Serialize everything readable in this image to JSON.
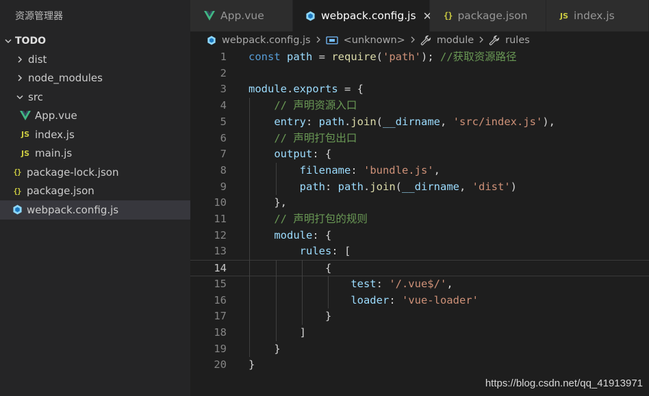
{
  "explorer": {
    "title": "资源管理器",
    "section": "TODO",
    "items": [
      {
        "label": "dist",
        "type": "folder"
      },
      {
        "label": "node_modules",
        "type": "folder"
      },
      {
        "label": "src",
        "type": "folder-open"
      },
      {
        "label": "App.vue",
        "type": "vue"
      },
      {
        "label": "index.js",
        "type": "js"
      },
      {
        "label": "main.js",
        "type": "js"
      },
      {
        "label": "package-lock.json",
        "type": "json"
      },
      {
        "label": "package.json",
        "type": "json"
      },
      {
        "label": "webpack.config.js",
        "type": "webpack",
        "selected": true
      }
    ]
  },
  "tabs": [
    {
      "label": "App.vue",
      "icon": "vue-icon"
    },
    {
      "label": "webpack.config.js",
      "icon": "webpack-icon",
      "active": true
    },
    {
      "label": "package.json",
      "icon": "json-icon"
    },
    {
      "label": "index.js",
      "icon": "js-icon"
    }
  ],
  "icons": {
    "js": "JS",
    "json": "{}",
    "close": "✕"
  },
  "breadcrumb": {
    "file": "webpack.config.js",
    "symbol": "<unknown>",
    "prop1": "module",
    "prop2": "rules"
  },
  "editor": {
    "current_line": 14,
    "lines": [
      {
        "n": "1",
        "tokens": [
          [
            "kw",
            "const"
          ],
          [
            "pl",
            " "
          ],
          [
            "var",
            "path"
          ],
          [
            "pl",
            " = "
          ],
          [
            "fn",
            "require"
          ],
          [
            "pl",
            "("
          ],
          [
            "str",
            "'path'"
          ],
          [
            "pl",
            "); "
          ],
          [
            "cm",
            "//获取资源路径"
          ]
        ]
      },
      {
        "n": "2",
        "tokens": []
      },
      {
        "n": "3",
        "tokens": [
          [
            "var",
            "module"
          ],
          [
            "pl",
            "."
          ],
          [
            "var",
            "exports"
          ],
          [
            "pl",
            " = {"
          ]
        ]
      },
      {
        "n": "4",
        "tokens": [
          [
            "pl",
            "    "
          ],
          [
            "cm",
            "// 声明资源入口"
          ]
        ]
      },
      {
        "n": "5",
        "tokens": [
          [
            "pl",
            "    "
          ],
          [
            "var",
            "entry"
          ],
          [
            "pl",
            ": "
          ],
          [
            "var",
            "path"
          ],
          [
            "pl",
            "."
          ],
          [
            "fn",
            "join"
          ],
          [
            "pl",
            "("
          ],
          [
            "var",
            "__dirname"
          ],
          [
            "pl",
            ", "
          ],
          [
            "str",
            "'src/index.js'"
          ],
          [
            "pl",
            "),"
          ]
        ]
      },
      {
        "n": "6",
        "tokens": [
          [
            "pl",
            "    "
          ],
          [
            "cm",
            "// 声明打包出口"
          ]
        ]
      },
      {
        "n": "7",
        "tokens": [
          [
            "pl",
            "    "
          ],
          [
            "var",
            "output"
          ],
          [
            "pl",
            ": {"
          ]
        ]
      },
      {
        "n": "8",
        "tokens": [
          [
            "pl",
            "        "
          ],
          [
            "var",
            "filename"
          ],
          [
            "pl",
            ": "
          ],
          [
            "str",
            "'bundle.js'"
          ],
          [
            "pl",
            ","
          ]
        ]
      },
      {
        "n": "9",
        "tokens": [
          [
            "pl",
            "        "
          ],
          [
            "var",
            "path"
          ],
          [
            "pl",
            ": "
          ],
          [
            "var",
            "path"
          ],
          [
            "pl",
            "."
          ],
          [
            "fn",
            "join"
          ],
          [
            "pl",
            "("
          ],
          [
            "var",
            "__dirname"
          ],
          [
            "pl",
            ", "
          ],
          [
            "str",
            "'dist'"
          ],
          [
            "pl",
            ")"
          ]
        ]
      },
      {
        "n": "10",
        "tokens": [
          [
            "pl",
            "    },"
          ]
        ]
      },
      {
        "n": "11",
        "tokens": [
          [
            "pl",
            "    "
          ],
          [
            "cm",
            "// 声明打包的规则"
          ]
        ]
      },
      {
        "n": "12",
        "tokens": [
          [
            "pl",
            "    "
          ],
          [
            "var",
            "module"
          ],
          [
            "pl",
            ": {"
          ]
        ]
      },
      {
        "n": "13",
        "tokens": [
          [
            "pl",
            "        "
          ],
          [
            "var",
            "rules"
          ],
          [
            "pl",
            ": ["
          ]
        ]
      },
      {
        "n": "14",
        "tokens": [
          [
            "pl",
            "            {"
          ]
        ]
      },
      {
        "n": "15",
        "tokens": [
          [
            "pl",
            "                "
          ],
          [
            "var",
            "test"
          ],
          [
            "pl",
            ": "
          ],
          [
            "str",
            "'/.vue$/'"
          ],
          [
            "pl",
            ","
          ]
        ]
      },
      {
        "n": "16",
        "tokens": [
          [
            "pl",
            "                "
          ],
          [
            "var",
            "loader"
          ],
          [
            "pl",
            ": "
          ],
          [
            "str",
            "'vue-loader'"
          ]
        ]
      },
      {
        "n": "17",
        "tokens": [
          [
            "pl",
            "            }"
          ]
        ]
      },
      {
        "n": "18",
        "tokens": [
          [
            "pl",
            "        ]"
          ]
        ]
      },
      {
        "n": "19",
        "tokens": [
          [
            "pl",
            "    }"
          ]
        ]
      },
      {
        "n": "20",
        "tokens": [
          [
            "pl",
            "}"
          ]
        ]
      }
    ]
  },
  "watermark": "https://blog.csdn.net/qq_41913971",
  "colors": {
    "sidebar_bg": "#252526",
    "editor_bg": "#1e1e1e",
    "selected_bg": "#37373d",
    "vue_green": "#41b883",
    "webpack_blue": "#8dd6f9"
  }
}
